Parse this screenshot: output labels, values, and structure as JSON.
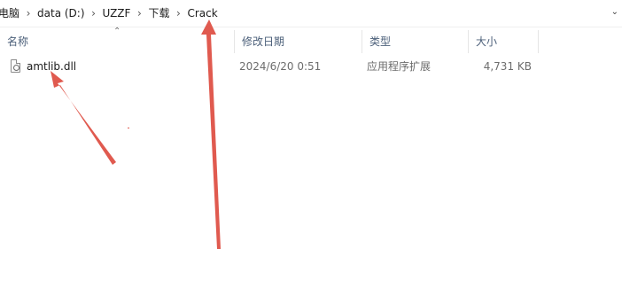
{
  "breadcrumb": {
    "items": [
      "电脑",
      "data (D:)",
      "UZZF",
      "下载",
      "Crack"
    ],
    "separator": "›"
  },
  "columns": {
    "name": "名称",
    "modified": "修改日期",
    "type": "类型",
    "size": "大小"
  },
  "files": [
    {
      "name": "amtlib.dll",
      "modified": "2024/6/20 0:51",
      "type": "应用程序扩展",
      "size": "4,731 KB",
      "icon": "dll-file-icon"
    }
  ],
  "annotations": {
    "arrow_color": "#e05a4f"
  }
}
